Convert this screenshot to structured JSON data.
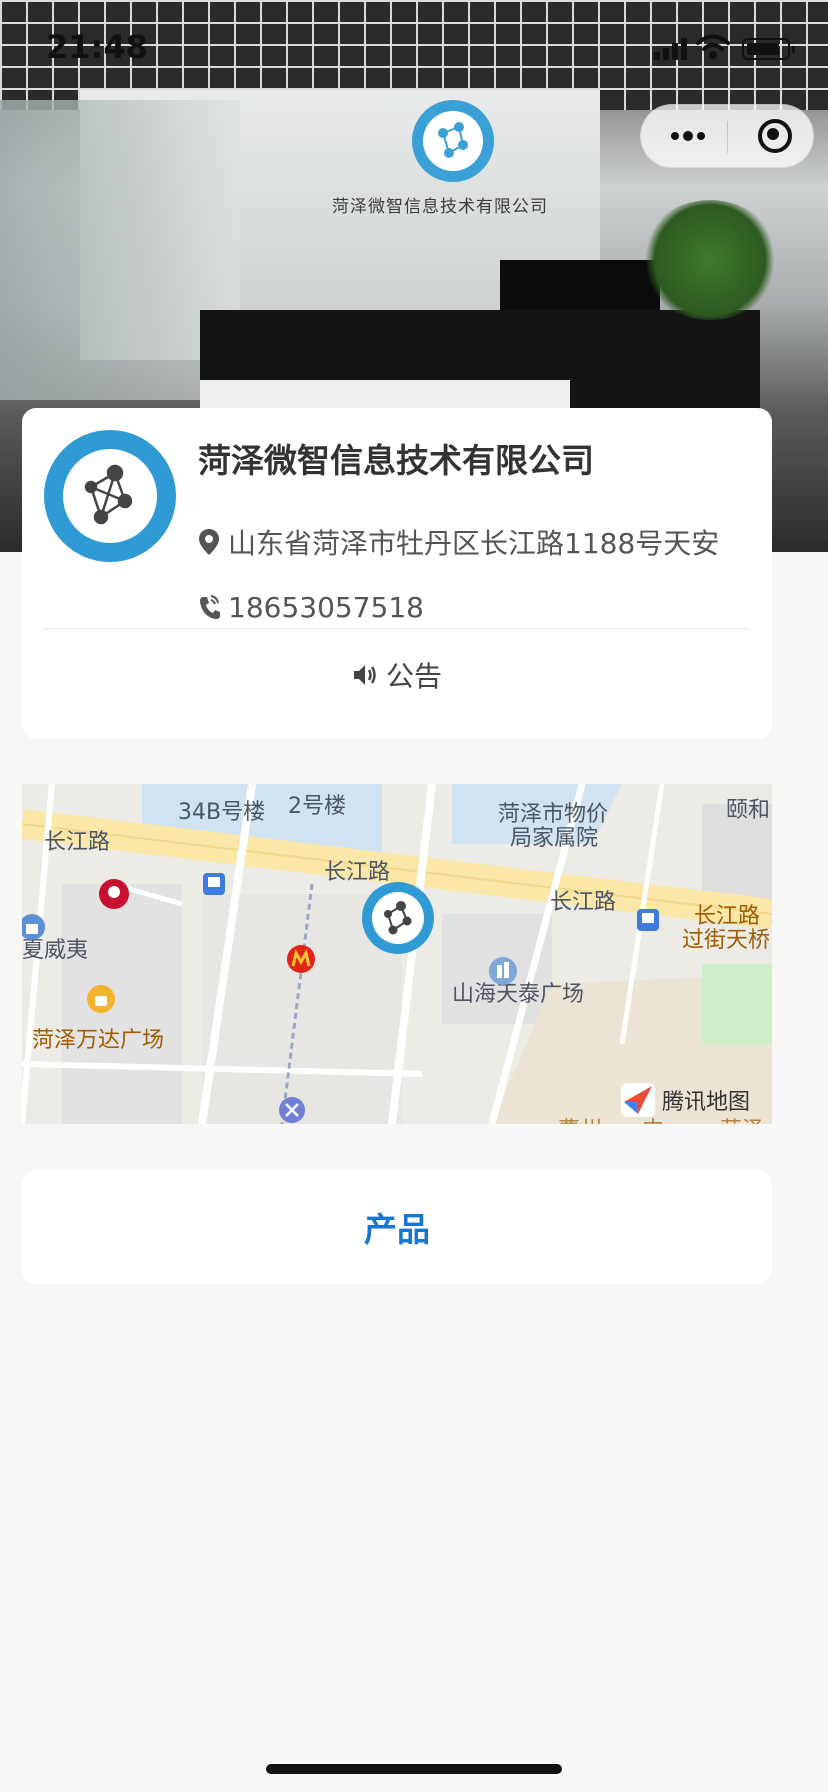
{
  "status_bar": {
    "time": "21:48"
  },
  "hero": {
    "sign_text": "菏泽微智信息技术有限公司"
  },
  "company": {
    "name": "菏泽微智信息技术有限公司",
    "address": "山东省菏泽市牡丹区长江路1188号天安",
    "phone": "18653057518",
    "notice_label": "公告"
  },
  "map": {
    "labels": {
      "building_34b": "34B号楼",
      "building_2": "2号楼",
      "price_bureau": "菏泽市物价",
      "price_bureau_2": "局家属院",
      "heyi": "颐和",
      "changjiang_road_1": "长江路",
      "changjiang_road_2": "长江路",
      "changjiang_road_3": "长江路",
      "changjiang_road_bridge": "长江路",
      "overpass": "过街天桥",
      "hawaii": "夏威夷",
      "wanda": "菏泽万达广场",
      "shanhai": "山海天泰广场",
      "bottom_1": "曹州",
      "bottom_2": "中",
      "bottom_3": "菏泽"
    },
    "brand": "腾讯地图"
  },
  "products_label": "产品",
  "colors": {
    "accent_blue": "#1677d2",
    "logo_blue": "#2f9ad3",
    "page_bg": "#f7f7f5"
  }
}
